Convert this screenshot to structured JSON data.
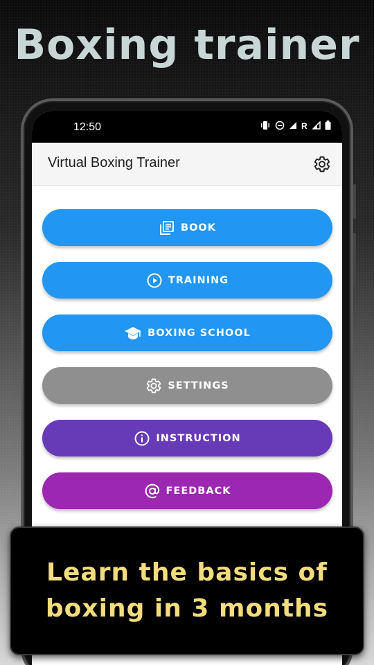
{
  "promo": {
    "title": "Boxing trainer",
    "banner_line1": "Learn the basics of",
    "banner_line2": "boxing in 3 months"
  },
  "status_bar": {
    "time": "12:50",
    "icons": [
      "vibrate-icon",
      "do-not-disturb-icon",
      "signal-icon",
      "roaming-icon",
      "signal-icon",
      "battery-icon"
    ]
  },
  "app_bar": {
    "title": "Virtual Boxing Trainer",
    "action_icon": "settings-gear-icon"
  },
  "menu": [
    {
      "label": "BOOK",
      "icon": "book-icon",
      "color": "#2196f3"
    },
    {
      "label": "TRAINING",
      "icon": "play-circle-icon",
      "color": "#2196f3"
    },
    {
      "label": "BOXING SCHOOL",
      "icon": "graduation-cap-icon",
      "color": "#2196f3"
    },
    {
      "label": "SETTINGS",
      "icon": "gear-icon",
      "color": "#8f8f8f"
    },
    {
      "label": "INSTRUCTION",
      "icon": "info-icon",
      "color": "#673ab7"
    },
    {
      "label": "FEEDBACK",
      "icon": "at-sign-icon",
      "color": "#9c27b0"
    }
  ]
}
